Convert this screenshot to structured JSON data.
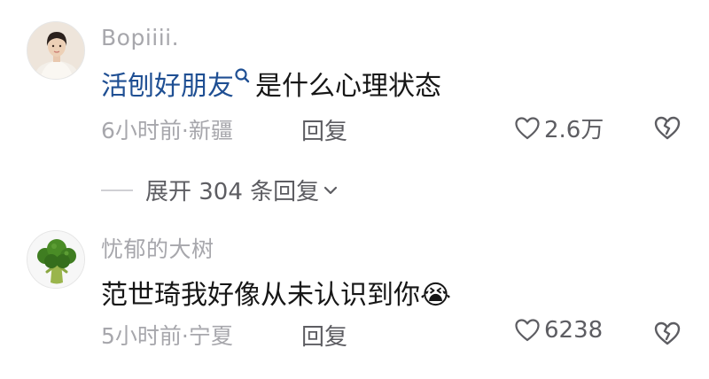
{
  "comments": [
    {
      "username": "Bopiiii.",
      "topic": "活刨好朋友",
      "text": "是什么心理状态",
      "time": "6小时前",
      "location": "新疆",
      "reply_label": "回复",
      "like_count": "2.6万",
      "avatar_icon": "woman-portrait-avatar"
    },
    {
      "username": "忧郁的大树",
      "text": "范世琦我好像从未认识到你",
      "emoji": "😭",
      "time": "5小时前",
      "location": "宁夏",
      "reply_label": "回复",
      "like_count": "6238",
      "avatar_icon": "broccoli-avatar"
    }
  ],
  "expand_replies": "展开 304 条回复",
  "separator": "·",
  "icons": {
    "like": "heart-outline-icon",
    "dislike": "broken-heart-icon",
    "expand": "chevron-down-icon",
    "topic_search": "search-icon"
  },
  "colors": {
    "topic": "#1f4f93",
    "meta": "#a7a7ac",
    "action": "#5d5d62"
  }
}
